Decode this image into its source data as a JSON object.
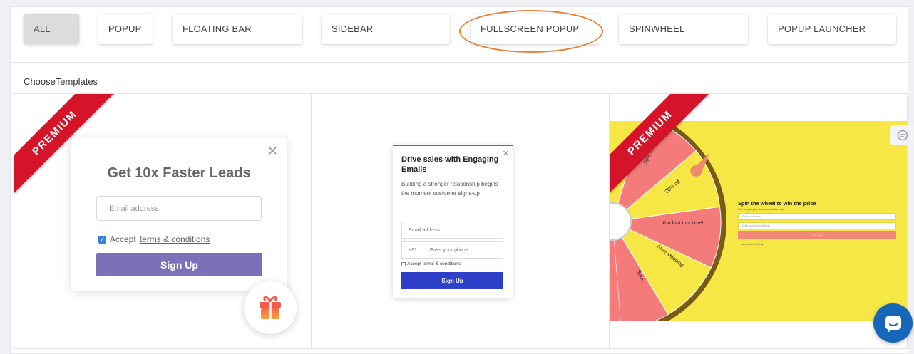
{
  "tabs": [
    {
      "label": "ALL",
      "active": true
    },
    {
      "label": "POPUP",
      "active": false
    },
    {
      "label": "FLOATING BAR",
      "active": false
    },
    {
      "label": "SIDEBAR",
      "active": false
    },
    {
      "label": "FULLSCREEN POPUP",
      "active": false,
      "highlighted": true
    },
    {
      "label": "SPINWHEEL",
      "active": false
    },
    {
      "label": "POPUP LAUNCHER",
      "active": false
    }
  ],
  "section_label": "ChooseTemplates",
  "ribbon_label": "PREMIUM",
  "template1": {
    "close": "✕",
    "title": "Get 10x Faster Leads",
    "email_placeholder": "Email address",
    "accept_text": "Accept",
    "terms_link": "terms & conditions",
    "signup": "Sign Up"
  },
  "template2": {
    "close": "✕",
    "title": "Drive sales with Engaging Emails",
    "subtitle": "Building a stronger relationship begins the moment customer signs-up",
    "email_placeholder": "Email address",
    "phone_code": "+91",
    "phone_placeholder": "Enter your phone",
    "accept_text": "Accept terms & conditions",
    "signup": "Sign Up"
  },
  "template3": {
    "wheel_slices": [
      "50% off",
      "20% off",
      "You lost this time!",
      "Free shipping",
      "Sorry"
    ],
    "title": "Spin the wheel to win the price",
    "subtitle": "Give a try on your chance to win the price!",
    "field1": "Enter your name",
    "field2": "Enter your email address",
    "button": "Let's Spin",
    "note": "No, I don't feel lucky"
  },
  "colors": {
    "ribbon": "#d5142a",
    "highlight_circle": "#e9823a",
    "template1_button": "#7a71b8",
    "template2_button": "#2d40c7",
    "wheel_background": "#f7e744",
    "wheel_slice_red": "#f57b7b",
    "chat_button": "#1667b7"
  },
  "icons": {
    "gift": "gift-icon",
    "side": "grammarly-icon",
    "chat": "chat-icon"
  }
}
